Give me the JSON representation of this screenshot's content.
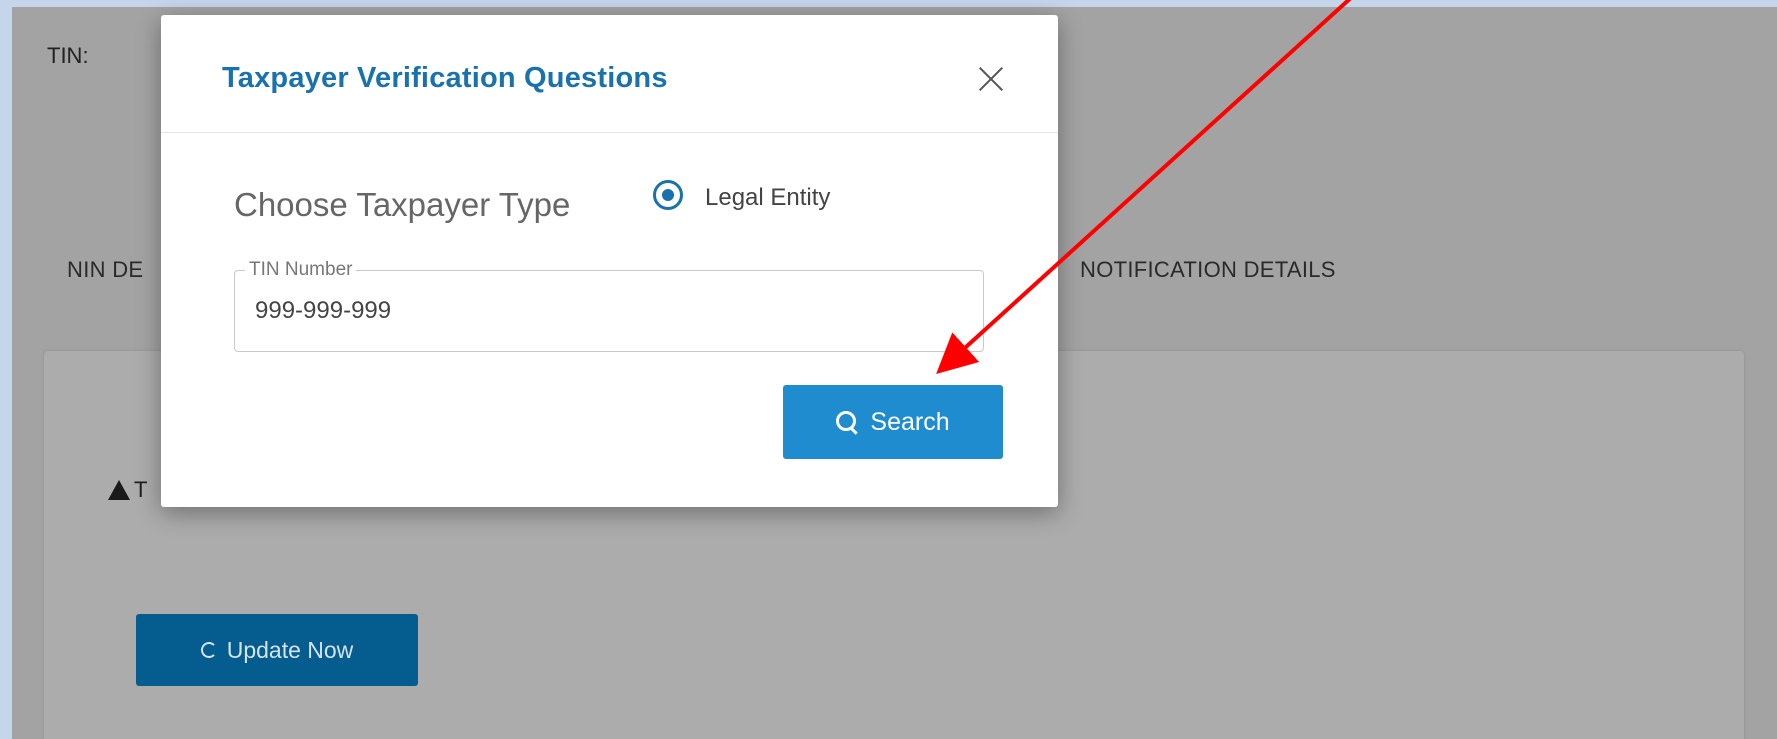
{
  "background": {
    "tin_label": "TIN:",
    "tab_left": "NIN DE",
    "tab_right": "NOTIFICATION DETAILS",
    "warning_text": "T",
    "update_button": "Update Now"
  },
  "modal": {
    "title": "Taxpayer Verification Questions",
    "taxpayer_type_label": "Choose Taxpayer Type",
    "radio_option_label": "Legal Entity",
    "tin_field_label": "TIN Number",
    "tin_field_value": "999-999-999",
    "search_button": "Search"
  },
  "colors": {
    "primary": "#1e8ccf",
    "title": "#1a72ad",
    "annotation_arrow": "#ff0000",
    "overlay": "#a3a3a3"
  },
  "icons": {
    "close": "close-icon",
    "search": "search-icon",
    "refresh": "refresh-icon",
    "warning": "warning-icon"
  }
}
